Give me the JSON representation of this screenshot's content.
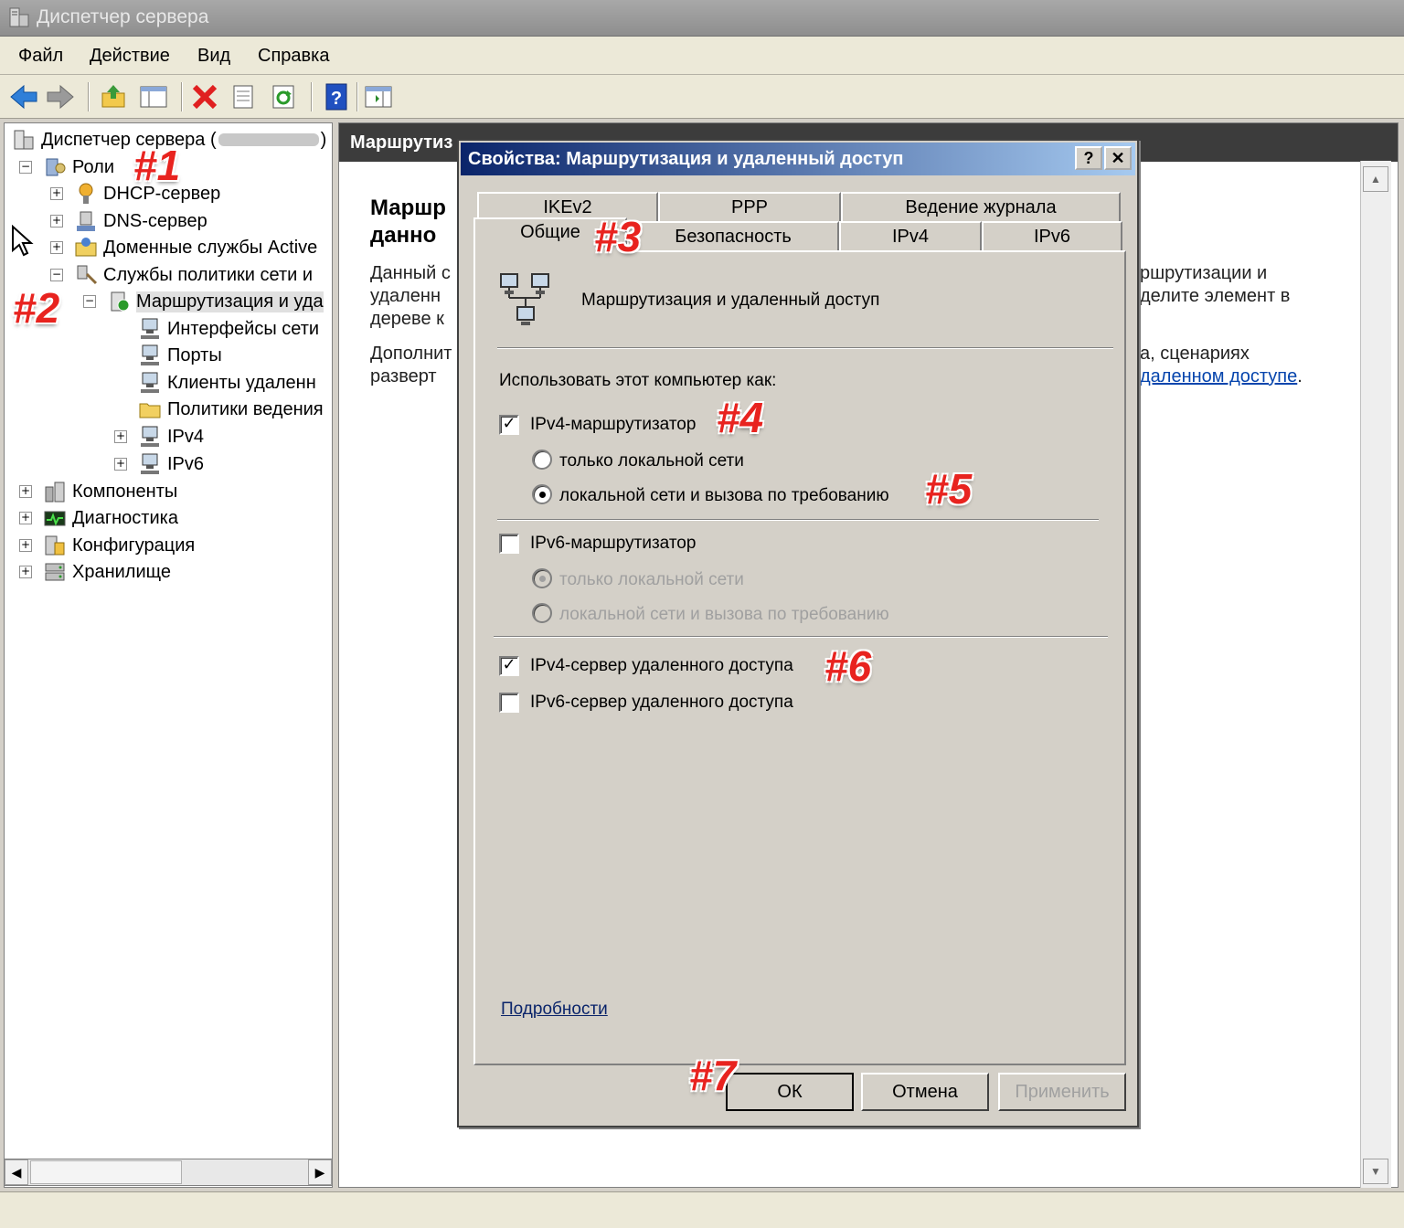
{
  "window": {
    "title": "Диспетчер сервера"
  },
  "menu": [
    "Файл",
    "Действие",
    "Вид",
    "Справка"
  ],
  "toolbar": {
    "icons": [
      "back-arrow-icon",
      "forward-arrow-icon",
      "up-folder-icon",
      "show-hide-tree-icon",
      "delete-icon",
      "properties-icon",
      "refresh-icon",
      "help-icon",
      "action-pane-icon"
    ]
  },
  "tree": {
    "root": "Диспетчер сервера (",
    "roles": "Роли",
    "dhcp": "DHCP-сервер",
    "dns": "DNS-сервер",
    "ad": "Доменные службы Active",
    "nps": "Службы политики сети и",
    "rras": "Маршрутизация и уда",
    "interfaces": "Интерфейсы сети",
    "ports": "Порты",
    "clients": "Клиенты удаленн",
    "logging": "Политики ведения",
    "ipv4": "IPv4",
    "ipv6": "IPv6",
    "features": "Компоненты",
    "diagnostics": "Диагностика",
    "configuration": "Конфигурация",
    "storage": "Хранилище"
  },
  "right": {
    "header": "Маршрутиз",
    "title1": "Маршр",
    "title2": "данно",
    "p1l1a": "Данный с",
    "p1l2a": "удаленн",
    "p1l3a": "дереве к",
    "p1l1b": "ршрутизации и",
    "p1l2b": "делите элемент в",
    "p2l1a": "Дополнит",
    "p2l2a": "разверт",
    "p2l1b": "а, сценариях",
    "p2l2link": "даленном доступе",
    "p2l2end": "."
  },
  "dialog": {
    "title": "Свойства: Маршрутизация и удаленный доступ",
    "help_btn": "?",
    "close_btn": "✕",
    "tabs_row1": [
      "IKEv2",
      "PPP",
      "Ведение журнала"
    ],
    "tabs_row2": [
      "Общие",
      "Безопасность",
      "IPv4",
      "IPv6"
    ],
    "service_name": "Маршрутизация и удаленный доступ",
    "use_as": "Использовать этот компьютер как:",
    "ipv4_router": {
      "label": "IPv4-маршрутизатор",
      "checked": true
    },
    "ipv4_lan_only": {
      "label": "только локальной сети",
      "selected": false
    },
    "ipv4_lan_dd": {
      "label": "локальной сети и вызова по требованию",
      "selected": true
    },
    "ipv6_router": {
      "label": "IPv6-маршрутизатор",
      "checked": false
    },
    "ipv6_lan_only": {
      "label": "только локальной сети",
      "selected": true
    },
    "ipv6_lan_dd": {
      "label": "локальной сети и вызова по требованию",
      "selected": false
    },
    "ipv4_ras": {
      "label": "IPv4-сервер удаленного доступа",
      "checked": true
    },
    "ipv6_ras": {
      "label": "IPv6-сервер удаленного доступа",
      "checked": false
    },
    "details_link": "Подробности",
    "ok": "ОК",
    "cancel": "Отмена",
    "apply": "Применить"
  },
  "annotations": [
    "#1",
    "#2",
    "#3",
    "#4",
    "#5",
    "#6",
    "#7"
  ],
  "colors": {
    "annotation": "#e8231f",
    "dialog_title": "#0a246a",
    "link": "#0645ad"
  }
}
